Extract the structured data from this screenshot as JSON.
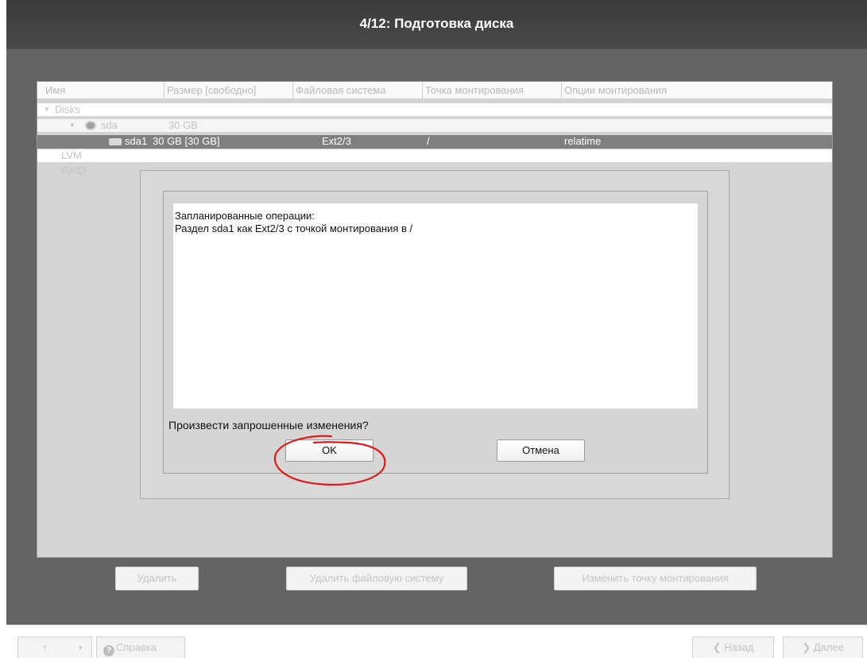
{
  "window": {
    "title": "4/12: Подготовка диска"
  },
  "tree": {
    "columns": [
      "Имя",
      "Размер [свободно]",
      "Файловая система",
      "Точка монтирования",
      "Опции монтирования"
    ],
    "disks_label": "Disks",
    "disk": {
      "name": "sda",
      "size": "30 GB"
    },
    "partition": {
      "name": "sda1",
      "size": "30 GB [30 GB]",
      "filesystem": "Ext2/3",
      "mount_point": "/",
      "options": "relatime"
    },
    "lvm_label": "LVM",
    "raid_label": "RAID"
  },
  "dialog": {
    "operations_heading": "Запланированные операции:",
    "operation_1": "Раздел sda1 как Ext2/3 с точкой монтирования в /",
    "question": "Произвести запрошенные изменения?",
    "ok_label": "OK",
    "cancel_label": "Отмена",
    "highlight_color": "#e01818"
  },
  "actions": {
    "delete_label": "Удалить",
    "delete_fs_label": "Удалить файловую систему",
    "change_mount_label": "Изменить точку монтирования"
  },
  "footer": {
    "up_arrow": "↑",
    "help_label": "Справка",
    "back_label": "Назад",
    "next_label": "Далее"
  }
}
